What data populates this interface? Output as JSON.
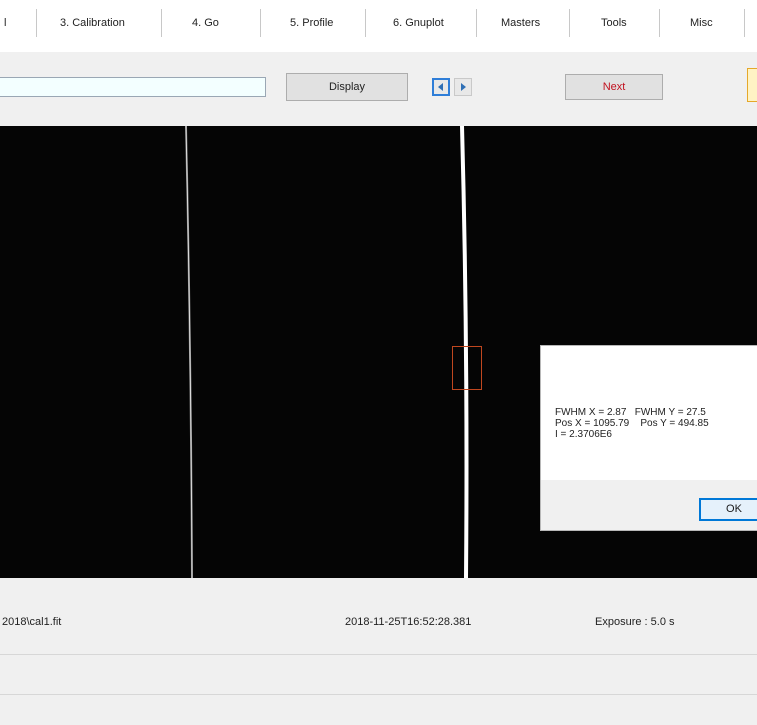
{
  "tabs": [
    {
      "label": "l"
    },
    {
      "label": "3. Calibration"
    },
    {
      "label": "4. Go"
    },
    {
      "label": "5. Profile"
    },
    {
      "label": "6. Gnuplot"
    },
    {
      "label": "Masters"
    },
    {
      "label": "Tools"
    },
    {
      "label": "Misc"
    }
  ],
  "toolbar": {
    "path_value": "",
    "display_label": "Display",
    "prev_icon": "arrow-left-icon",
    "next_icon": "arrow-right-icon",
    "next_label": "Next"
  },
  "dialog": {
    "line1": "FWHM X = 2.87   FWHM Y = 27.5",
    "line2": "Pos X = 1095.79    Pos Y = 494.85",
    "line3": "I = 2.3706E6",
    "ok_label": "OK"
  },
  "status": {
    "file": "2018\\cal1.fit",
    "datetime": "2018-11-25T16:52:28.381",
    "exposure": "Exposure : 5.0 s"
  },
  "colors": {
    "accent": "#0078d7",
    "next_text": "#c1121f",
    "input_bg": "#f3ffff",
    "viewer_bg": "#050505",
    "marker": "#c0471f"
  }
}
